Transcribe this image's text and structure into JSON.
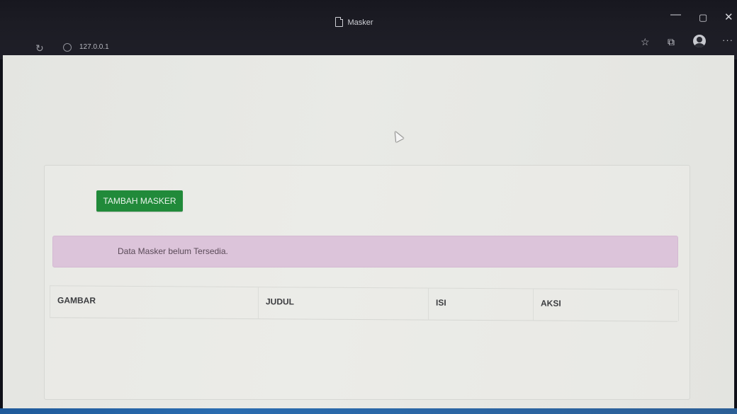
{
  "window": {
    "tab_title": "Masker",
    "minimize_glyph": "—",
    "maximize_glyph": "▢",
    "close_glyph": "✕"
  },
  "toolbar": {
    "url": "127.0.0.1",
    "refresh_glyph": "↻",
    "favorites_glyph": "☆",
    "collections_glyph": "⧉",
    "more_glyph": "···"
  },
  "page": {
    "add_button_label": "TAMBAH MASKER",
    "add_button_color": "#218a3a",
    "empty_alert": "Data Masker belum Tersedia.",
    "alert_color": "#dcc4da",
    "table_headers": [
      "GAMBAR",
      "JUDUL",
      "ISI",
      "AKSI"
    ]
  },
  "icons": {
    "tab": "document-icon",
    "refresh": "refresh-icon",
    "site": "site-info-icon",
    "favorites": "favorites-icon",
    "collections": "collections-icon",
    "profile": "profile-icon",
    "more": "more-options-icon"
  }
}
